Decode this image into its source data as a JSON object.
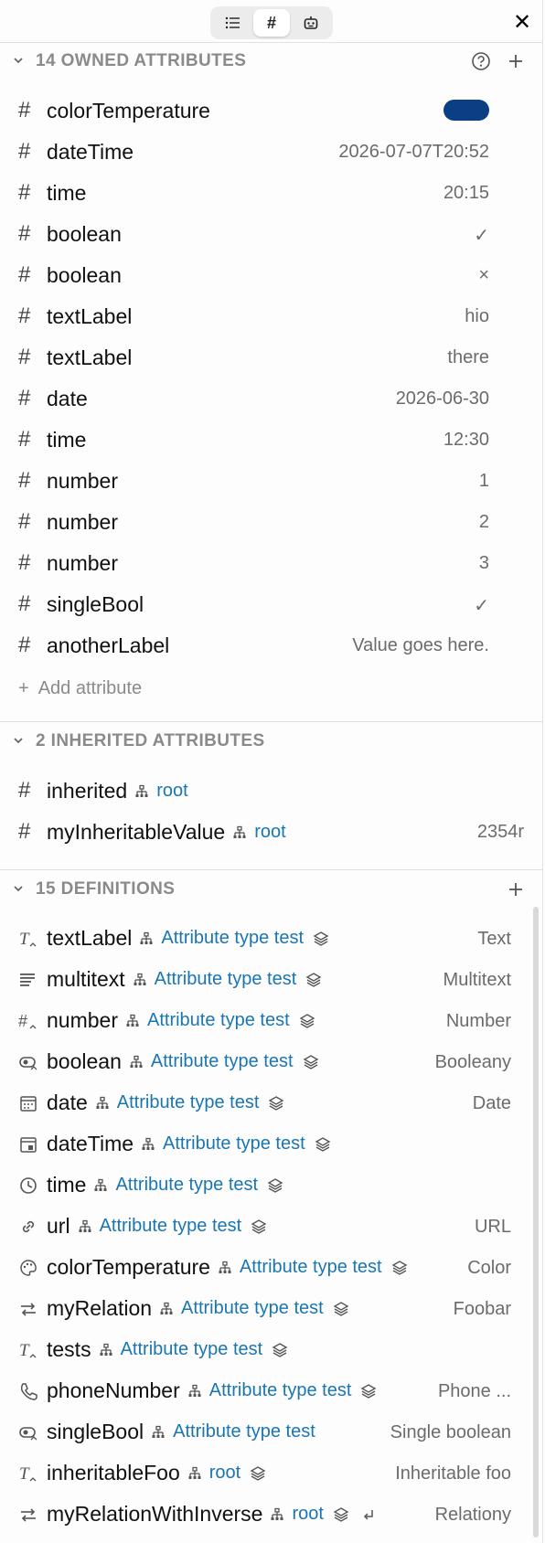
{
  "toolbar": {
    "close_label": "✕"
  },
  "owned": {
    "title": "14 OWNED ATTRIBUTES",
    "rows": [
      {
        "name": "colorTemperature",
        "value": "",
        "color": "#0b3f84"
      },
      {
        "name": "dateTime",
        "value": "2026-07-07T20:52"
      },
      {
        "name": "time",
        "value": "20:15"
      },
      {
        "name": "boolean",
        "value": "✓"
      },
      {
        "name": "boolean",
        "value": "×"
      },
      {
        "name": "textLabel",
        "value": "hio"
      },
      {
        "name": "textLabel",
        "value": "there"
      },
      {
        "name": "date",
        "value": "2026-06-30"
      },
      {
        "name": "time",
        "value": "12:30"
      },
      {
        "name": "number",
        "value": "1"
      },
      {
        "name": "number",
        "value": "2"
      },
      {
        "name": "number",
        "value": "3"
      },
      {
        "name": "singleBool",
        "value": "✓"
      },
      {
        "name": "anotherLabel",
        "value": "Value goes here."
      }
    ],
    "add_label": "Add attribute"
  },
  "inherited": {
    "title": "2 INHERITED ATTRIBUTES",
    "rows": [
      {
        "name": "inherited",
        "source": "root",
        "value": ""
      },
      {
        "name": "myInheritableValue",
        "source": "root",
        "value": "2354r"
      }
    ]
  },
  "definitions": {
    "title": "15 DEFINITIONS",
    "rows": [
      {
        "type_icon": "text-type-icon",
        "name": "textLabel",
        "source": "Attribute type test",
        "value": "Text"
      },
      {
        "type_icon": "multitext-type-icon",
        "name": "multitext",
        "source": "Attribute type test",
        "value": "Multitext"
      },
      {
        "type_icon": "number-type-icon",
        "name": "number",
        "source": "Attribute type test",
        "value": "Number"
      },
      {
        "type_icon": "boolean-type-icon",
        "name": "boolean",
        "source": "Attribute type test",
        "value": "Booleany"
      },
      {
        "type_icon": "date-type-icon",
        "name": "date",
        "source": "Attribute type test",
        "value": "Date"
      },
      {
        "type_icon": "datetime-type-icon",
        "name": "dateTime",
        "source": "Attribute type test",
        "value": ""
      },
      {
        "type_icon": "time-type-icon",
        "name": "time",
        "source": "Attribute type test",
        "value": ""
      },
      {
        "type_icon": "url-type-icon",
        "name": "url",
        "source": "Attribute type test",
        "value": "URL"
      },
      {
        "type_icon": "color-type-icon",
        "name": "colorTemperature",
        "source": "Attribute type test",
        "value": "Color"
      },
      {
        "type_icon": "relation-type-icon",
        "name": "myRelation",
        "source": "Attribute type test",
        "value": "Foobar"
      },
      {
        "type_icon": "text-type-icon",
        "name": "tests",
        "source": "Attribute type test",
        "value": ""
      },
      {
        "type_icon": "phone-type-icon",
        "name": "phoneNumber",
        "source": "Attribute type test",
        "value": "Phone ..."
      },
      {
        "type_icon": "boolean-type-icon",
        "name": "singleBool",
        "source": "Attribute type test",
        "value": "Single boolean"
      },
      {
        "type_icon": "text-type-icon",
        "name": "inheritableFoo",
        "source": "root",
        "value": "Inheritable foo"
      },
      {
        "type_icon": "relation-type-icon",
        "name": "myRelationWithInverse",
        "source": "root",
        "value": "Relationy"
      }
    ]
  }
}
